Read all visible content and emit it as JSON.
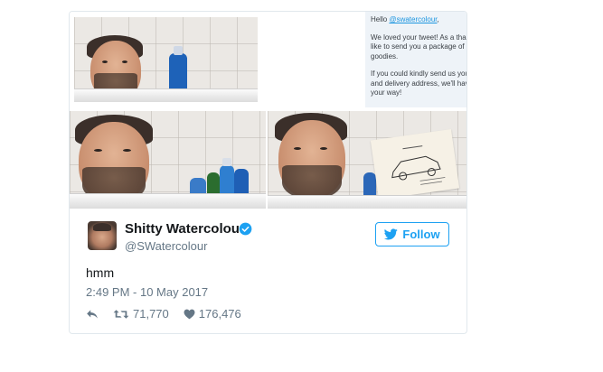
{
  "dm": {
    "greeting": "Hello ",
    "mention": "@swatercolour",
    "greeting_end": ",",
    "paragraph1": "We loved your tweet! As a thanks, we'd like to send you a package of Radox goodies.",
    "paragraph2": "If you could kindly send us your name and delivery address, we'll have it sent your way!"
  },
  "author": {
    "name": "Shitty Watercolour",
    "handle": "@SWatercolour"
  },
  "follow_label": "Follow",
  "tweet": {
    "text": "hmm",
    "timestamp": "2:49 PM - 10 May 2017"
  },
  "stats": {
    "retweets": "71,770",
    "likes": "176,476"
  },
  "colors": {
    "accent": "#1da1f2",
    "secondary_text": "#657786",
    "dm_background": "#eef3f8"
  },
  "icons": [
    "verified-badge-icon",
    "twitter-bird-icon",
    "reply-icon",
    "retweet-icon",
    "heart-icon"
  ]
}
